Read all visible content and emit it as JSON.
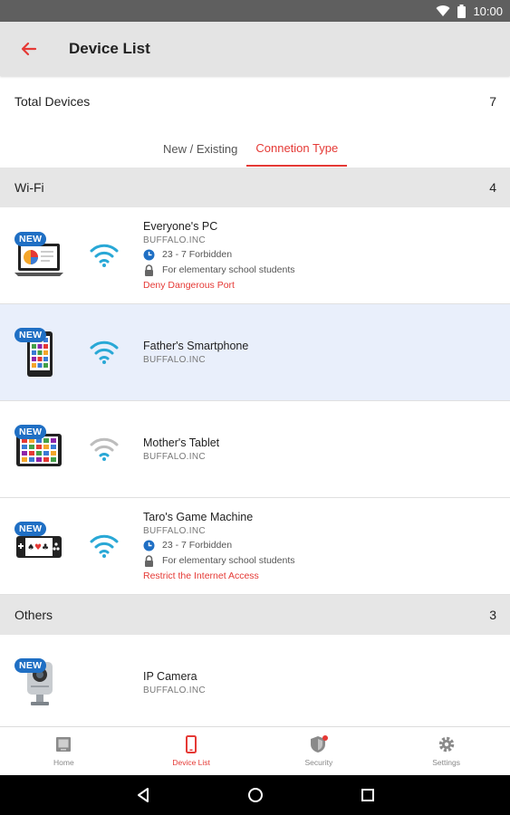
{
  "status_bar": {
    "time": "10:00",
    "icons": [
      "wifi-icon",
      "battery-icon"
    ]
  },
  "app_bar": {
    "title": "Device List",
    "back_icon": "arrow-left-icon"
  },
  "summary": {
    "label": "Total Devices",
    "count": "7"
  },
  "tabs": [
    {
      "label": "New / Existing",
      "active": false
    },
    {
      "label": "Connetion Type",
      "active": true
    }
  ],
  "sections": [
    {
      "label": "Wi-Fi",
      "count": "4"
    },
    {
      "label": "Others",
      "count": "3"
    }
  ],
  "badge_label": "NEW",
  "devices": [
    {
      "name": "Everyone's PC",
      "vendor": "BUFFALO.INC",
      "icon": "laptop-icon",
      "connection_icon": "wifi-icon",
      "schedule": "23 - 7 Forbidden",
      "filter": "For elementary school students",
      "warning": "Deny Dangerous Port",
      "selected": false
    },
    {
      "name": "Father's Smartphone",
      "vendor": "BUFFALO.INC",
      "icon": "smartphone-icon",
      "connection_icon": "wifi-icon",
      "selected": true
    },
    {
      "name": "Mother's Tablet",
      "vendor": "BUFFALO.INC",
      "icon": "tablet-icon",
      "connection_icon": "wifi-icon",
      "selected": false
    },
    {
      "name": "Taro's Game Machine",
      "vendor": "BUFFALO.INC",
      "icon": "game-controller-icon",
      "connection_icon": "wifi-icon",
      "schedule": "23 - 7 Forbidden",
      "filter": "For elementary school students",
      "warning": "Restrict the Internet Access",
      "selected": false
    },
    {
      "name": "IP Camera",
      "vendor": "BUFFALO.INC",
      "icon": "camera-icon",
      "selected": false
    }
  ],
  "bottom_nav": [
    {
      "label": "Home",
      "icon": "home-icon",
      "active": false
    },
    {
      "label": "Device List",
      "icon": "device-icon",
      "active": true
    },
    {
      "label": "Security",
      "icon": "shield-icon",
      "active": false
    },
    {
      "label": "Settings",
      "icon": "gear-icon",
      "active": false
    }
  ],
  "colors": {
    "accent": "#e53935",
    "badge": "#1f6fc4",
    "wifi_active": "#29a8d6",
    "wifi_inactive": "#bdbdbd",
    "selected_row": "#e9effb"
  }
}
